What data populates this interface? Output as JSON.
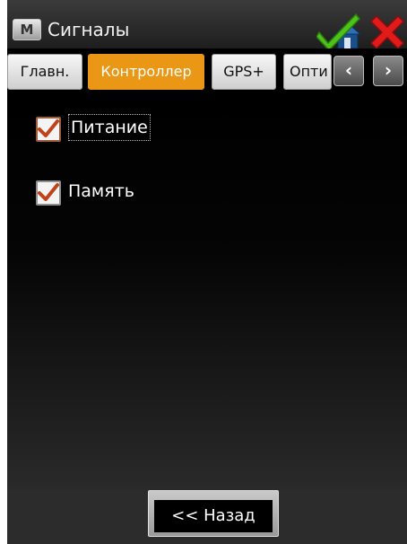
{
  "titlebar": {
    "app_icon_letter": "M",
    "title": "Сигналы",
    "ok_icon": "checkmark-home-icon",
    "close_icon": "red-x-icon"
  },
  "tabs": [
    {
      "label": "Главн.",
      "active": false
    },
    {
      "label": "Контроллер",
      "active": true
    },
    {
      "label": "GPS+",
      "active": false
    },
    {
      "label": "Опти",
      "active": false
    }
  ],
  "tab_scroll": {
    "left_glyph": "‹",
    "right_glyph": "›"
  },
  "options": [
    {
      "label": "Питание",
      "checked": true
    },
    {
      "label": "Память",
      "checked": true
    }
  ],
  "footer": {
    "back_label": "<< Назад"
  },
  "colors": {
    "active_tab": "#e99714",
    "check_mark": "#c0421a",
    "close_red": "#e11a1a",
    "ok_green": "#4cc21b",
    "background": "#000000"
  }
}
